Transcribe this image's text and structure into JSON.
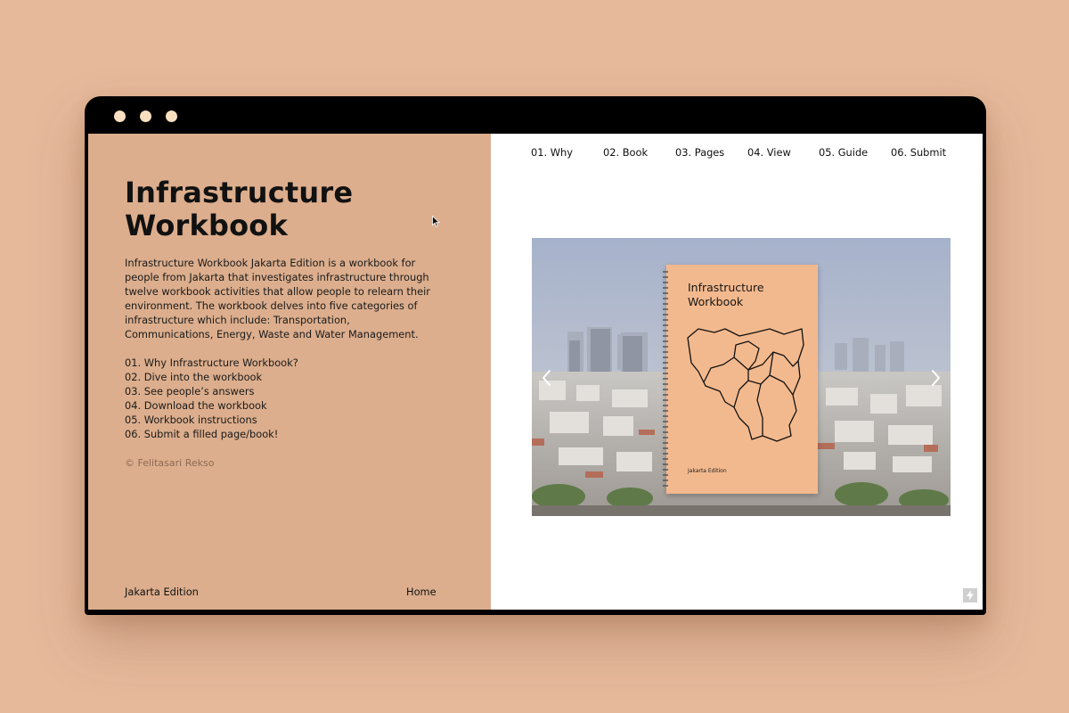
{
  "window_controls": [
    "dot",
    "dot",
    "dot"
  ],
  "sidebar": {
    "title": "Infrastructure Workbook",
    "description": "Infrastructure Workbook Jakarta Edition is a workbook for people from Jakarta that investigates infrastructure through twelve workbook activities that allow people to relearn their environment. The workbook delves into five categories of infrastructure which include: Transportation, Communications, Energy, Waste and Water Management.",
    "toc": [
      "01. Why Infrastructure Workbook?",
      "02. Dive into the workbook",
      "03. See people’s answers",
      "04. Download the workbook",
      "05. Workbook instructions",
      "06. Submit a filled page/book!"
    ],
    "copyright": "© Felitasari Rekso",
    "footer_left": "Jakarta Edition",
    "footer_right": "Home"
  },
  "nav": [
    "01. Why",
    "02. Book",
    "03. Pages",
    "04. View",
    "05.  Guide",
    "06. Submit"
  ],
  "slider": {
    "book_title": "Infrastructure Workbook",
    "book_edition": "Jakarta Edition",
    "prev_icon": "chevron-left-icon",
    "next_icon": "chevron-right-icon"
  },
  "corner_icon": "lightning-icon",
  "colors": {
    "background": "#e6b99b",
    "sidebar": "#dcae8d",
    "window_dots": "#f7dfbf",
    "book_cover": "#f3b98e"
  }
}
